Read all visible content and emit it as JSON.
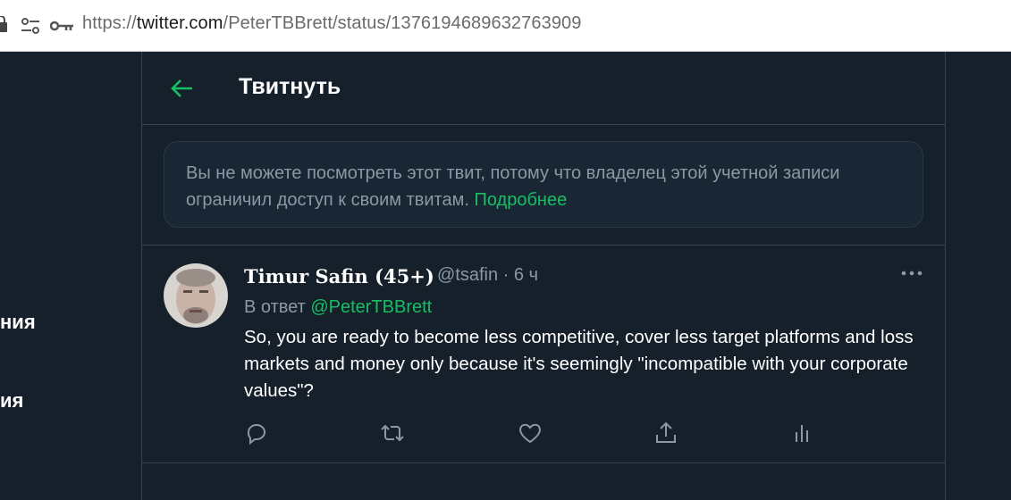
{
  "browser": {
    "url_prefix": "https://",
    "url_host": "twitter.com",
    "url_path": "/PeterTBBrett/status/1376194689632763909"
  },
  "nav": {
    "item1": "ния",
    "item2": "ия"
  },
  "header": {
    "title": "Твитнуть"
  },
  "notice": {
    "text": "Вы не можете посмотреть этот твит, потому что владелец этой учетной записи ограничил доступ к своим твитам.",
    "link": "Подробнее"
  },
  "tweet": {
    "name": "Timur Safin (45+)",
    "handle": "@tsafin",
    "separator": " · ",
    "time": "6 ч",
    "reply_prefix": "В ответ ",
    "reply_to": "@PeterTBBrett",
    "text": "So, you are ready to become less competitive, cover less target platforms and loss markets and money only because it's seemingly \"incompatible with your corporate values\"?"
  },
  "colors": {
    "background": "#15202b",
    "accent": "#17bf63",
    "secondary_text": "#8b98a5"
  }
}
